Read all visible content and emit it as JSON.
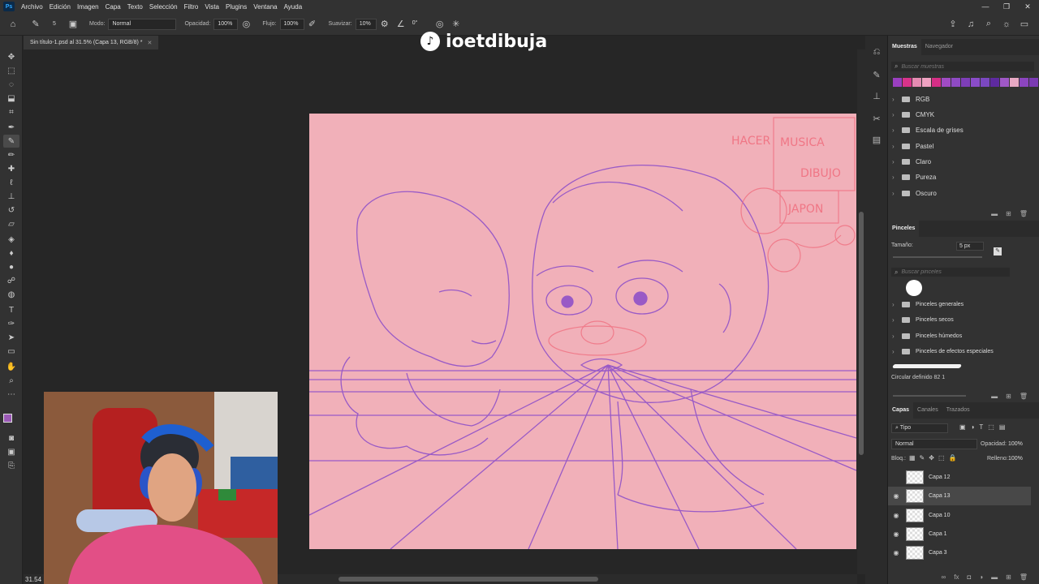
{
  "menubar": {
    "app_logo": "Ps",
    "items": [
      "Archivo",
      "Edición",
      "Imagen",
      "Capa",
      "Texto",
      "Selección",
      "Filtro",
      "Vista",
      "Plugins",
      "Ventana",
      "Ayuda"
    ]
  },
  "options": {
    "mode_label": "Modo:",
    "mode_value": "Normal",
    "opacity_label": "Opacidad:",
    "opacity_value": "100%",
    "flow_label": "Flujo:",
    "flow_value": "100%",
    "smooth_label": "Suavizar:",
    "smooth_value": "10%",
    "angle_value": "0°",
    "brush_size_small": "5"
  },
  "document": {
    "tab_title": "Sin título-1.psd al 31.5% (Capa 13, RGB/8) *",
    "zoom": "31.54"
  },
  "brand": {
    "name": "ioetdibuja"
  },
  "sketch_text": {
    "line1": "HACER",
    "line2": "MUSICA",
    "line3": "DIBUJO",
    "line4": "JAPON"
  },
  "swatches_panel": {
    "tabs": [
      "Muestras",
      "Navegador"
    ],
    "search_placeholder": "Buscar muestras",
    "colors": [
      "#9a3fc0",
      "#d9338a",
      "#e58bb2",
      "#f0a2c2",
      "#d62e86",
      "#a04bc4",
      "#8f4ac4",
      "#7e3eb8",
      "#8a4cc9",
      "#7b48c0",
      "#5e2aa0",
      "#9f58c6",
      "#e8a9c4",
      "#8c45bf",
      "#7b3bb3"
    ],
    "groups": [
      "RGB",
      "CMYK",
      "Escala de grises",
      "Pastel",
      "Claro",
      "Pureza",
      "Oscuro"
    ]
  },
  "brushes_panel": {
    "title": "Pinceles",
    "size_label": "Tamaño:",
    "size_value": "5 px",
    "search_placeholder": "Buscar pinceles",
    "groups": [
      "Pinceles generales",
      "Pinceles secos",
      "Pinceles húmedos",
      "Pinceles de efectos especiales"
    ],
    "preset_name": "Circular definido 82 1"
  },
  "layers_panel": {
    "tabs": [
      "Capas",
      "Canales",
      "Trazados"
    ],
    "filter_label": "Tipo",
    "blend_mode": "Normal",
    "opacity_label": "Opacidad:",
    "opacity_value": "100%",
    "lock_label": "Bloq.:",
    "fill_label": "Relleno:",
    "fill_value": "100%",
    "layers": [
      {
        "name": "Capa 12",
        "visible": false,
        "selected": false
      },
      {
        "name": "Capa 13",
        "visible": true,
        "selected": true
      },
      {
        "name": "Capa 10",
        "visible": true,
        "selected": false
      },
      {
        "name": "Capa 1",
        "visible": true,
        "selected": false
      },
      {
        "name": "Capa 3",
        "visible": true,
        "selected": false
      }
    ]
  },
  "colors": {
    "canvas_bg": "#f1b0b9",
    "sketch_stroke": "#8a4cc9",
    "sketch_red": "#f07080",
    "foreground": "#9b59b6",
    "background": "#f3a5b5"
  }
}
